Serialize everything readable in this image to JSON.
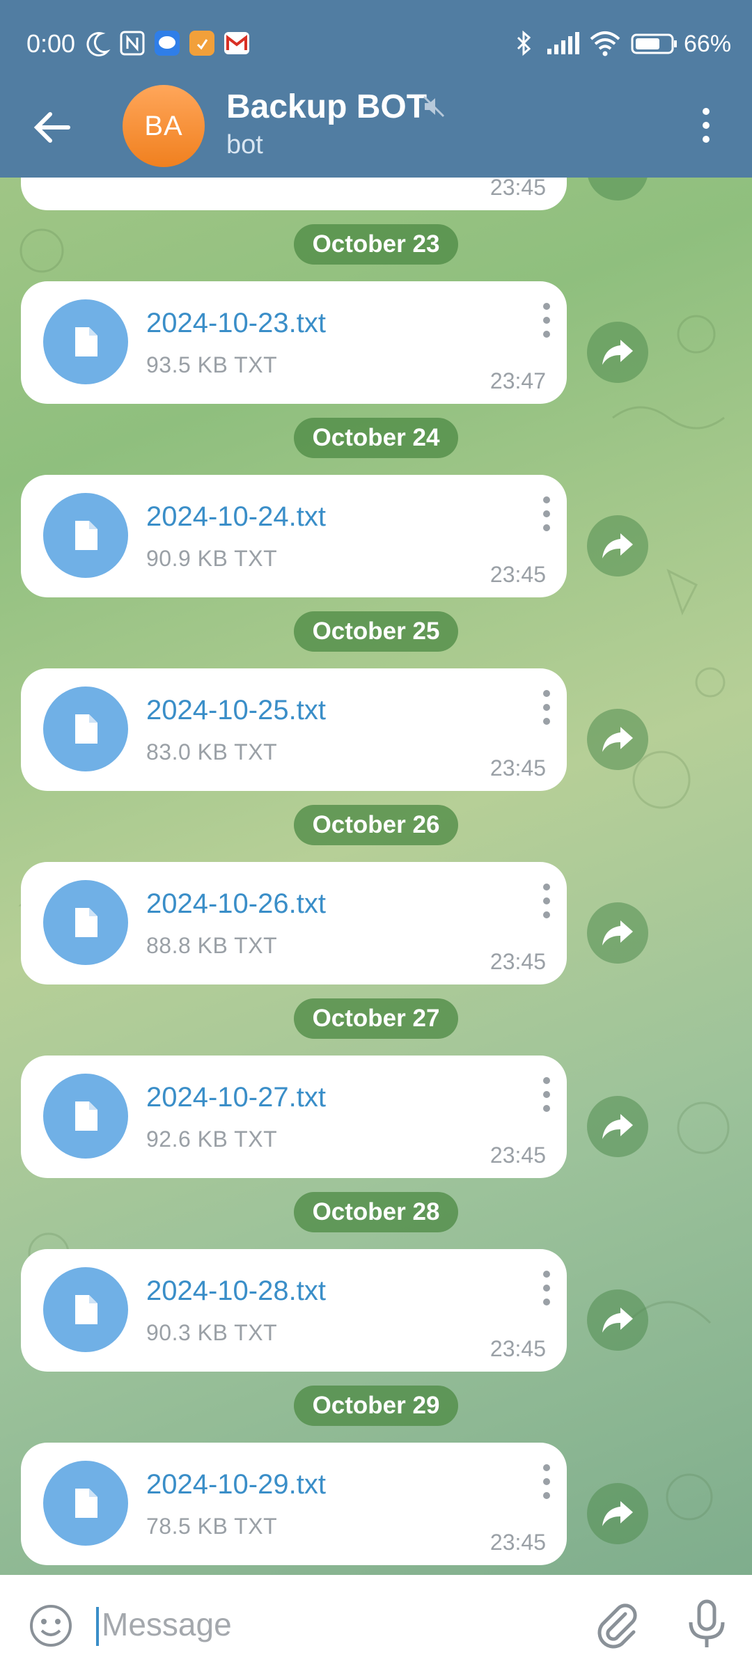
{
  "status_bar": {
    "time": "0:00",
    "battery": "66%"
  },
  "header": {
    "avatar_initials": "BA",
    "title": "Backup BOT",
    "subtitle": "bot"
  },
  "composer": {
    "placeholder": "Message"
  },
  "messages": [
    {
      "date": "October 23",
      "file": "2024-10-23.txt",
      "size": "93.5 KB TXT",
      "time": "23:47"
    },
    {
      "date": "October 24",
      "file": "2024-10-24.txt",
      "size": "90.9 KB TXT",
      "time": "23:45"
    },
    {
      "date": "October 25",
      "file": "2024-10-25.txt",
      "size": "83.0 KB TXT",
      "time": "23:45"
    },
    {
      "date": "October 26",
      "file": "2024-10-26.txt",
      "size": "88.8 KB TXT",
      "time": "23:45"
    },
    {
      "date": "October 27",
      "file": "2024-10-27.txt",
      "size": "92.6 KB TXT",
      "time": "23:45"
    },
    {
      "date": "October 28",
      "file": "2024-10-28.txt",
      "size": "90.3 KB TXT",
      "time": "23:45"
    },
    {
      "date": "October 29",
      "file": "2024-10-29.txt",
      "size": "78.5 KB TXT",
      "time": "23:45"
    }
  ],
  "partial_previous": {
    "time": "23:45"
  },
  "colors": {
    "header": "#517da2",
    "accent": "#3a8ec8",
    "file_icon": "#70b0e6",
    "avatar": "#f0801f"
  }
}
